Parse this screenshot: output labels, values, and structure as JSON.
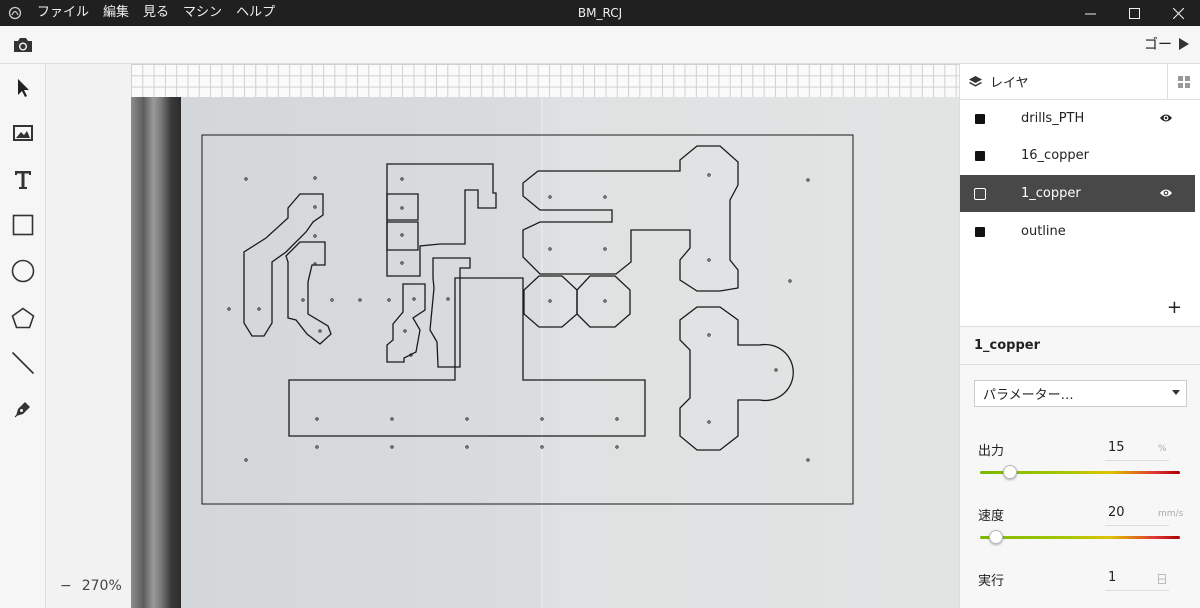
{
  "window": {
    "title": "BM_RCJ",
    "menu": [
      "ファイル",
      "編集",
      "見る",
      "マシン",
      "ヘルプ"
    ]
  },
  "toolbar": {
    "go_label": "ゴー"
  },
  "tools": [
    "select-tool",
    "image-tool",
    "text-tool",
    "rectangle-tool",
    "circle-tool",
    "polygon-tool",
    "line-tool",
    "pen-tool"
  ],
  "canvas": {
    "zoom": "270%",
    "zoom_out_label": "−"
  },
  "layers_panel": {
    "title": "レイヤ",
    "layers": [
      {
        "name": "drills_PTH",
        "visible": true,
        "selected": false
      },
      {
        "name": "16_copper",
        "visible": false,
        "selected": false
      },
      {
        "name": "1_copper",
        "visible": true,
        "selected": true
      },
      {
        "name": "outline",
        "visible": false,
        "selected": false
      }
    ],
    "add_label": "+"
  },
  "properties": {
    "layer_name": "1_copper",
    "preset_placeholder": "パラメーター…",
    "power": {
      "label": "出力",
      "value": "15",
      "unit": "%",
      "level": 0.15
    },
    "speed": {
      "label": "速度",
      "value": "20",
      "unit": "mm/s",
      "level": 0.08
    },
    "passes": {
      "label": "実行",
      "value": "1"
    }
  },
  "colors": {
    "selected_layer_bg": "#484848",
    "titlebar_bg": "#202020"
  }
}
